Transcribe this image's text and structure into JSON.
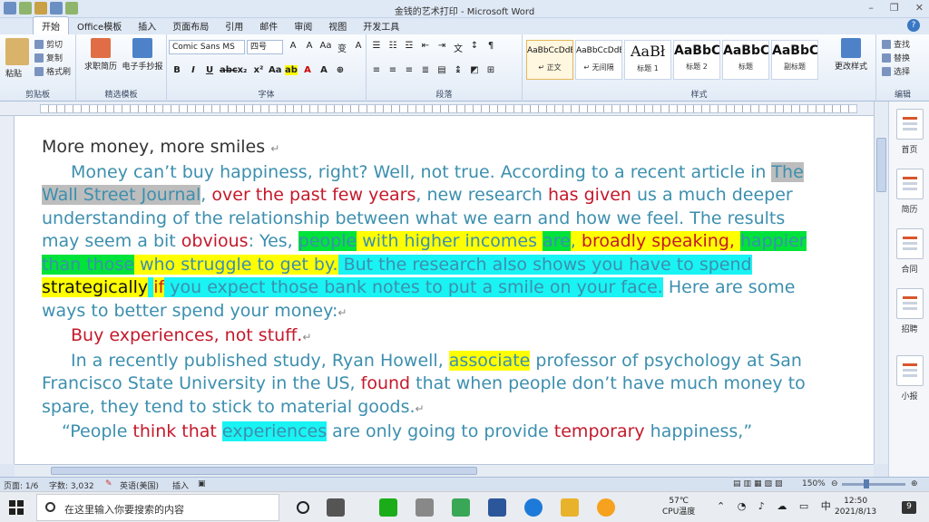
{
  "window": {
    "title": "金钱的艺术打印 - Microsoft Word",
    "controls": [
      "–",
      "❐",
      "✕"
    ]
  },
  "ribbon_tabs": [
    "开始",
    "Office模板",
    "插入",
    "页面布局",
    "引用",
    "邮件",
    "审阅",
    "视图",
    "开发工具"
  ],
  "clipboard": {
    "paste": "粘贴",
    "cut": "剪切",
    "copy": "复制",
    "format_painter": "格式刷",
    "label": "剪贴板"
  },
  "templates": {
    "resume": "求职简历",
    "handout": "电子手抄报",
    "label": "精选模板"
  },
  "font": {
    "family": "Comic Sans MS",
    "size": "四号",
    "label": "字体"
  },
  "paragraph_label": "段落",
  "styles": {
    "items": [
      {
        "preview": "AaBbCcDdE",
        "name": "↵ 正文"
      },
      {
        "preview": "AaBbCcDdE",
        "name": "↵ 无间隔"
      },
      {
        "preview": "AaBł",
        "name": "标题 1"
      },
      {
        "preview": "AaBbC",
        "name": "标题 2"
      },
      {
        "preview": "AaBbC",
        "name": "标题"
      },
      {
        "preview": "AaBbC",
        "name": "副标题"
      }
    ],
    "change": "更改样式",
    "label": "样式"
  },
  "editing": {
    "find": "查找",
    "replace": "替换",
    "select": "选择",
    "label": "编辑"
  },
  "document": {
    "title": "More money, more smiles",
    "p1": [
      "Money can’t buy happiness, right? Well, not true. According to a recent article in ",
      "The Wall Street Journal",
      ", ",
      "over the past few years",
      ", new research ",
      "has given",
      " us a much deeper understanding of the relationship between what we earn and how we feel. The results may seem a bit ",
      "obvious",
      ": Yes, ",
      "people",
      " with higher incomes ",
      "are",
      ", ",
      "broadly speaking,",
      " ",
      "happier than those",
      " who struggle to get by.",
      " But the research also shows you have to spend ",
      "strategically",
      " ",
      "if",
      " you expect those bank notes to put a smile on your face.",
      " Here are some ways to better spend your money:"
    ],
    "heading2": "Buy experiences, not stuff.",
    "p2": [
      "In a recently published study, Ryan Howell, ",
      "associate",
      " professor of psychology at San Francisco State University in the US, ",
      "found",
      " that when people don’t have much money to spare, they tend to stick to material goods."
    ],
    "p3": [
      "“People ",
      "think that",
      " ",
      "experiences",
      " are only going to provide ",
      "temporary",
      " happiness,”"
    ]
  },
  "side_panel": [
    "首页",
    "简历",
    "合同",
    "招聘",
    "小报"
  ],
  "status_bar": {
    "page": "页面: 1/6",
    "words": "字数: 3,032",
    "language": "英语(美国)",
    "mode": "插入",
    "zoom": "150%"
  },
  "taskbar": {
    "search_placeholder": "在这里输入你要搜索的内容",
    "temp": "57℃",
    "cpu_label": "CPU温度",
    "time": "12:50",
    "date": "2021/8/13",
    "notifications": "9"
  }
}
